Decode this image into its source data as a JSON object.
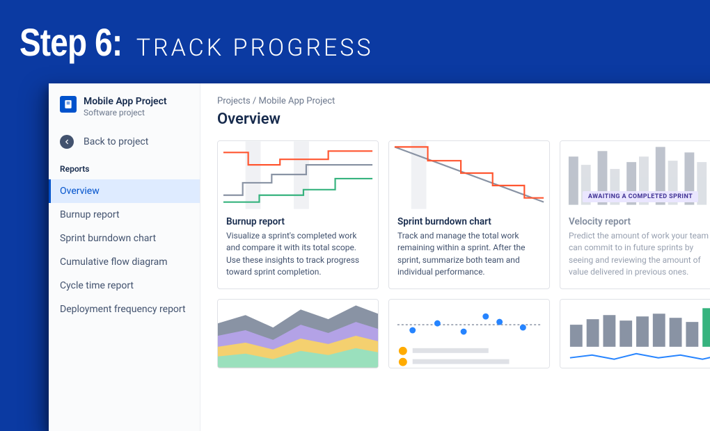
{
  "slide": {
    "step_label": "Step 6:",
    "title": "TRACK PROGRESS"
  },
  "sidebar": {
    "project_name": "Mobile App Project",
    "project_type": "Software project",
    "back_label": "Back to project",
    "section_label": "Reports",
    "items": [
      {
        "label": "Overview",
        "active": true
      },
      {
        "label": "Burnup report",
        "active": false
      },
      {
        "label": "Sprint burndown chart",
        "active": false
      },
      {
        "label": "Cumulative flow diagram",
        "active": false
      },
      {
        "label": "Cycle time report",
        "active": false
      },
      {
        "label": "Deployment frequency report",
        "active": false
      }
    ]
  },
  "breadcrumb": {
    "parent": "Projects",
    "separator": " / ",
    "current": "Mobile App Project"
  },
  "page_title": "Overview",
  "cards": [
    {
      "title": "Burnup report",
      "desc": "Visualize a sprint's completed work and compare it with its total scope. Use these insights to track progress toward sprint completion.",
      "badge": null
    },
    {
      "title": "Sprint burndown chart",
      "desc": "Track and manage the total work remaining within a sprint. After the sprint, summarize both team and individual performance.",
      "badge": null
    },
    {
      "title": "Velocity report",
      "desc": "Predict the amount of work your team can commit to in future sprints by seeing and reviewing the amount of value delivered in previous ones.",
      "badge": "AWAITING A COMPLETED SPRINT"
    },
    {
      "title": "",
      "desc": "",
      "badge": null
    },
    {
      "title": "",
      "desc": "",
      "badge": null
    },
    {
      "title": "",
      "desc": "",
      "badge": null
    }
  ]
}
